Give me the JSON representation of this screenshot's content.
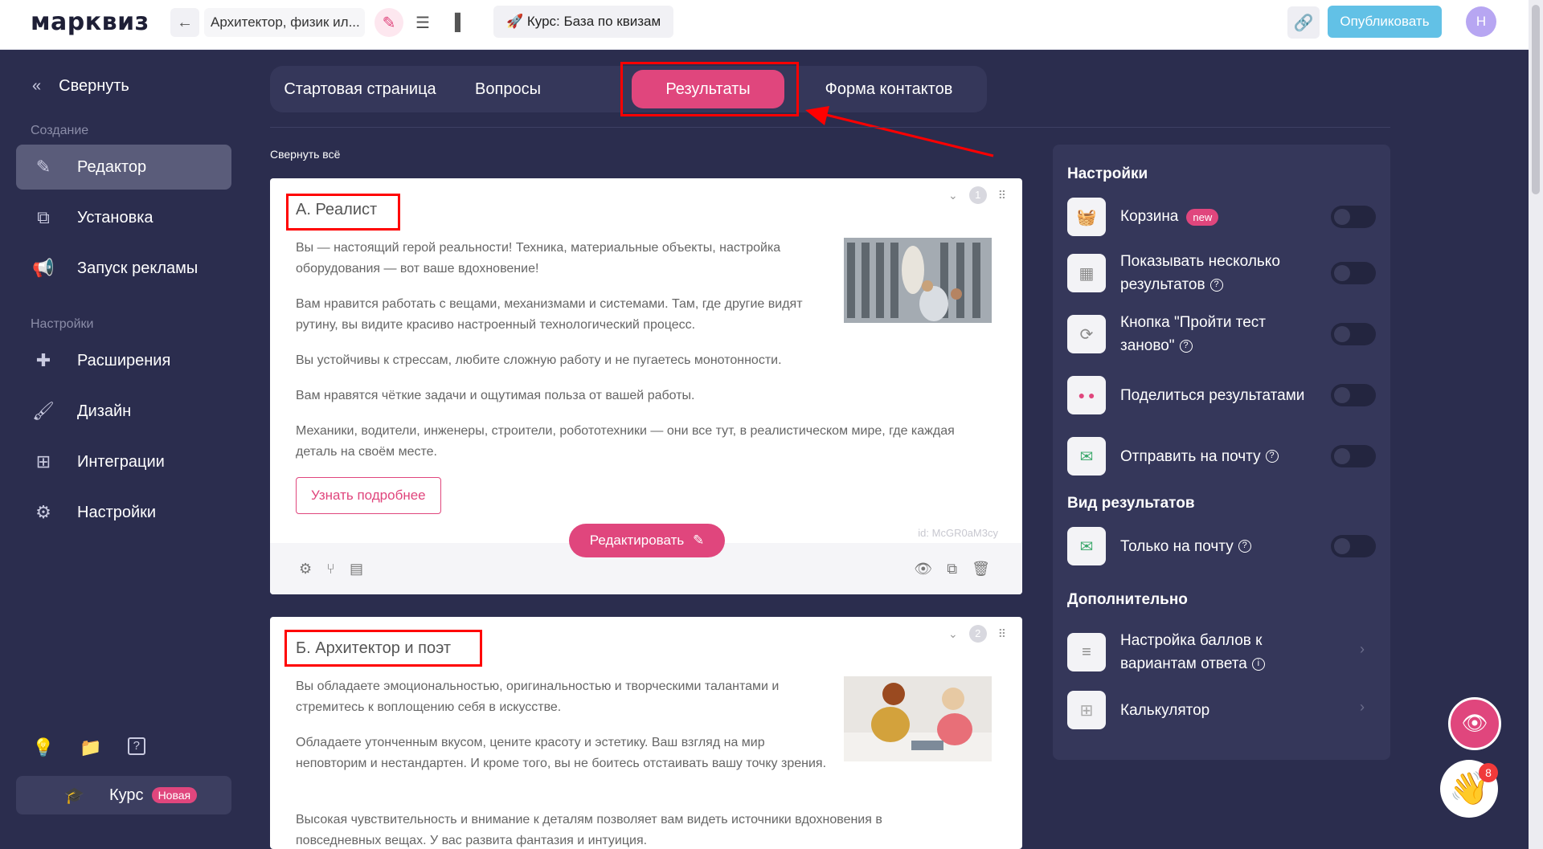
{
  "topbar": {
    "logo": "марквиз",
    "quiz_title": "Архитектор, физик ил...",
    "course_button": "🚀 Курс: База по квизам",
    "publish_label": "Опубликовать",
    "avatar_letter": "Н"
  },
  "sidebar": {
    "collapse_label": "Свернуть",
    "section_create": "Создание",
    "section_settings": "Настройки",
    "items": [
      {
        "label": "Редактор",
        "icon": "pencil-icon",
        "active": true
      },
      {
        "label": "Установка",
        "icon": "install-icon"
      },
      {
        "label": "Запуск рекламы",
        "icon": "megaphone-icon"
      },
      {
        "label": "Расширения",
        "icon": "puzzle-icon"
      },
      {
        "label": "Дизайн",
        "icon": "brush-icon"
      },
      {
        "label": "Интеграции",
        "icon": "integrations-icon"
      },
      {
        "label": "Настройки",
        "icon": "gear-icon"
      }
    ],
    "course_label": "Курс",
    "course_badge": "Новая"
  },
  "tabs": [
    {
      "label": "Стартовая страница"
    },
    {
      "label": "Вопросы"
    },
    {
      "label": "Результаты",
      "active": true
    },
    {
      "label": "Форма контактов"
    }
  ],
  "collapse_all": "Свернуть всё",
  "results": [
    {
      "number": "1",
      "title": "А. Реалист",
      "paragraphs": [
        "Вы — настоящий герой реальности! Техника, материальные объекты, настройка оборудования — вот ваше вдохновение!",
        "Вам нравится работать с вещами, механизмами и системами. Там, где другие видят рутину, вы видите красиво настроенный технологический процесс.",
        "Вы устойчивы к стрессам, любите сложную работу и не пугаетесь монотонности.",
        "Вам нравятся чёткие задачи и ощутимая польза от вашей работы.",
        "Механики, водители, инженеры, строители, робототехники — они все тут, в реалистическом мире, где каждая деталь на своём месте."
      ],
      "button": "Узнать подробнее",
      "id": "id: McGR0aM3cy",
      "edit_button": "Редактировать"
    },
    {
      "number": "2",
      "title": "Б. Архитектор и поэт",
      "paragraphs": [
        "Вы обладаете эмоциональностью, оригинальностью и творческими талантами и стремитесь к воплощению себя в искусстве.",
        "Обладаете утонченным вкусом, цените красоту и эстетику. Ваш взгляд на мир неповторим и нестандартен. И кроме того, вы не боитесь отстаивать вашу точку зрения.",
        "Высокая чувствительность и внимание к деталям позволяет вам видеть источники вдохновения в повседневных вещах. У вас развита фантазия и интуиция."
      ]
    }
  ],
  "settings": {
    "heading": "Настройки",
    "rows": [
      {
        "label": "Корзина",
        "badge": "new",
        "icon": "basket-icon"
      },
      {
        "label": "Показывать несколько результатов",
        "help": "?",
        "icon": "cards-icon"
      },
      {
        "label": "Кнопка \"Пройти тест заново\"",
        "help": "?",
        "icon": "restart-icon"
      },
      {
        "label": "Поделиться результатами",
        "icon": "share-icon"
      },
      {
        "label": "Отправить на почту",
        "help": "?",
        "icon": "mail-icon"
      }
    ],
    "view_heading": "Вид результатов",
    "view_rows": [
      {
        "label": "Только на почту",
        "help": "?",
        "icon": "mail-icon"
      }
    ],
    "extra_heading": "Дополнительно",
    "extra_rows": [
      {
        "label": "Настройка баллов к вариантам ответа",
        "help": "i",
        "icon": "score-icon"
      },
      {
        "label": "Калькулятор",
        "icon": "calculator-icon"
      }
    ]
  },
  "floating": {
    "notification_count": "8"
  },
  "colors": {
    "accent": "#e0467d",
    "sidebar_bg": "#2b2d4e",
    "publish": "#62c1e6",
    "annotation_red": "#ff0000"
  }
}
